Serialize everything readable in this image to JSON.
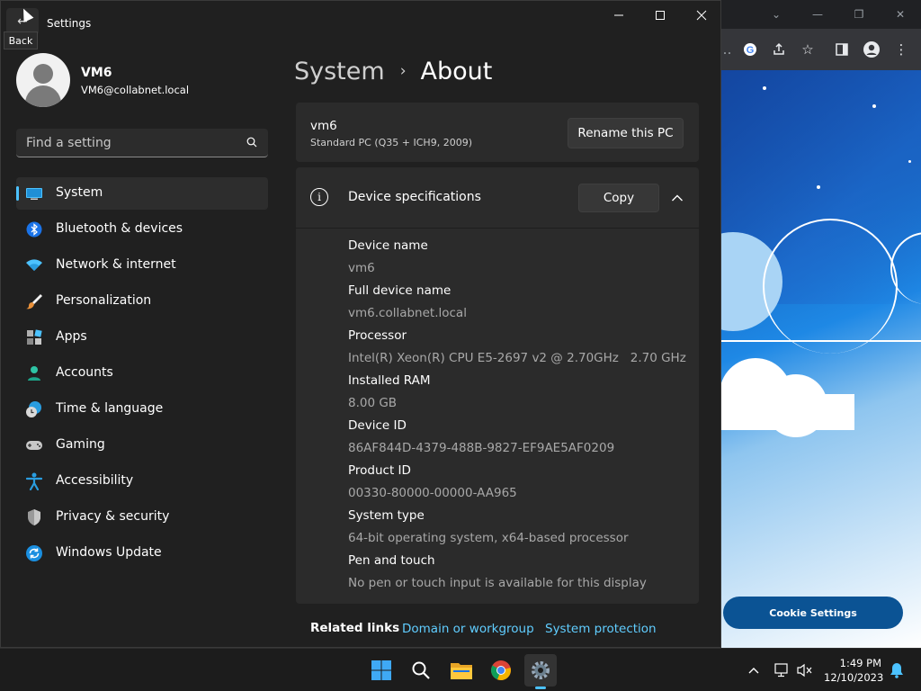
{
  "window": {
    "title": "Settings",
    "back_tooltip": "Back"
  },
  "profile": {
    "name": "VM6",
    "email": "VM6@collabnet.local"
  },
  "search": {
    "placeholder": "Find a setting"
  },
  "nav": {
    "items": [
      {
        "label": "System",
        "icon": "system-icon",
        "active": true
      },
      {
        "label": "Bluetooth & devices",
        "icon": "bluetooth-icon"
      },
      {
        "label": "Network & internet",
        "icon": "wifi-icon"
      },
      {
        "label": "Personalization",
        "icon": "paintbrush-icon"
      },
      {
        "label": "Apps",
        "icon": "apps-icon"
      },
      {
        "label": "Accounts",
        "icon": "person-icon"
      },
      {
        "label": "Time & language",
        "icon": "globe-clock-icon"
      },
      {
        "label": "Gaming",
        "icon": "gamepad-icon"
      },
      {
        "label": "Accessibility",
        "icon": "accessibility-icon"
      },
      {
        "label": "Privacy & security",
        "icon": "shield-icon"
      },
      {
        "label": "Windows Update",
        "icon": "update-icon"
      }
    ]
  },
  "breadcrumb": {
    "parent": "System",
    "separator": "›",
    "current": "About"
  },
  "pc": {
    "name": "vm6",
    "model": "Standard PC (Q35 + ICH9, 2009)",
    "rename_label": "Rename this PC"
  },
  "specs": {
    "title": "Device specifications",
    "copy_label": "Copy",
    "rows": [
      {
        "label": "Device name",
        "value": "vm6"
      },
      {
        "label": "Full device name",
        "value": "vm6.collabnet.local"
      },
      {
        "label": "Processor",
        "value": "Intel(R) Xeon(R) CPU E5-2697 v2 @ 2.70GHz   2.70 GHz"
      },
      {
        "label": "Installed RAM",
        "value": "8.00 GB"
      },
      {
        "label": "Device ID",
        "value": "86AF844D-4379-488B-9827-EF9AE5AF0209"
      },
      {
        "label": "Product ID",
        "value": "00330-80000-00000-AA965"
      },
      {
        "label": "System type",
        "value": "64-bit operating system, x64-based processor"
      },
      {
        "label": "Pen and touch",
        "value": "No pen or touch input is available for this display"
      }
    ]
  },
  "related": {
    "title": "Related links",
    "links": [
      "Domain or workgroup",
      "System protection"
    ]
  },
  "browser": {
    "cookie_button": "Cookie Settings"
  },
  "taskbar": {
    "apps": [
      "start-icon",
      "search-icon",
      "file-explorer-icon",
      "chrome-icon",
      "settings-icon"
    ],
    "time": "1:49 PM",
    "date": "12/10/2023"
  },
  "colors": {
    "accent": "#4cc2ff",
    "link": "#60cdff",
    "window_bg": "#202020",
    "card_bg": "#2b2b2b"
  }
}
